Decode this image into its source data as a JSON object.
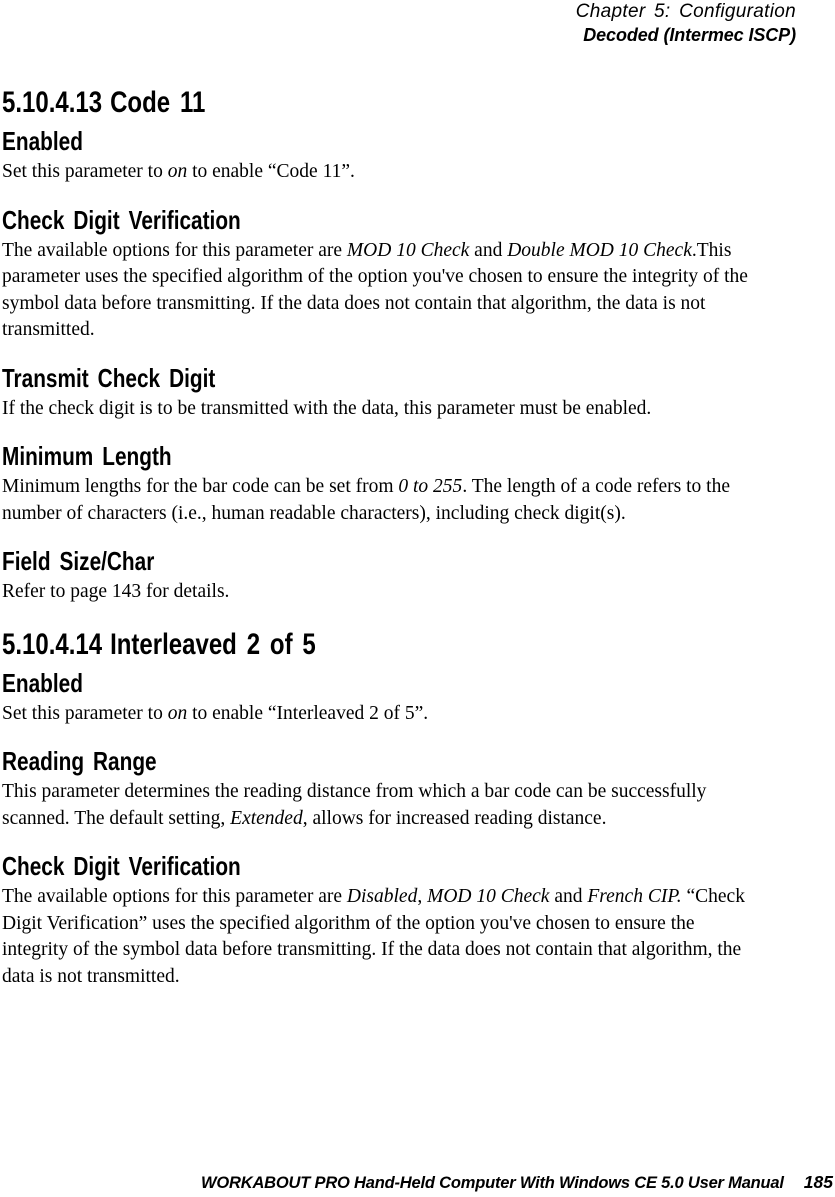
{
  "header": {
    "chapter_line": "Chapter 5: Configuration",
    "section_line": "Decoded (Intermec ISCP)"
  },
  "footer": {
    "manual_title": "WORKABOUT PRO Hand-Held Computer With Windows CE 5.0 User Manual",
    "page_number": "185"
  },
  "sections": [
    {
      "number": "5.10.4.13",
      "title": "Code 11",
      "blocks": [
        {
          "heading": "Enabled",
          "para_pre": "Set this parameter to ",
          "para_em": "on",
          "para_post": " to enable “Code 11”."
        },
        {
          "heading": "Check Digit Verification",
          "p1_pre": "The available options for this parameter are ",
          "p1_em1": "MOD 10 Check",
          "p1_mid": " and ",
          "p1_em2": "Double MOD 10 Check",
          "p1_post": ".This parameter uses the specified algorithm of the option you've chosen to ensure the integrity of the symbol data before transmitting. If the data does not contain that algorithm, the data is not transmitted."
        },
        {
          "heading": "Transmit Check Digit",
          "para": "If the check digit is to be transmitted with the data, this parameter must be enabled."
        },
        {
          "heading": "Minimum Length",
          "p_pre": "Minimum lengths for the bar code can be set from ",
          "p_em": "0 to 255",
          "p_post": ". The length of a code refers to the number of characters (i.e., human readable characters), including check digit(s)."
        },
        {
          "heading": "Field Size/Char",
          "para": "Refer to page 143 for details."
        }
      ]
    },
    {
      "number": "5.10.4.14",
      "title": "Interleaved 2 of 5",
      "blocks": [
        {
          "heading": "Enabled",
          "para_pre": "Set this parameter to ",
          "para_em": "on",
          "para_post": " to enable “Interleaved 2 of 5”."
        },
        {
          "heading": "Reading Range",
          "p_pre": "This parameter determines the reading distance from which a bar code can be successfully scanned. The default setting, ",
          "p_em": "Extended",
          "p_post": ", allows for increased reading distance."
        },
        {
          "heading": "Check Digit Verification",
          "p_pre": "The available options for this parameter are ",
          "p_em1": "Disabled",
          "p_mid1": ", ",
          "p_em2": "MOD 10 Check",
          "p_mid2": " and ",
          "p_em3": "French CIP.",
          "p_post": " “Check Digit Verification” uses the specified algorithm of the option you've chosen to ensure the integrity of the symbol data before transmitting. If the data does not contain that algorithm, the data is not transmitted."
        }
      ]
    }
  ]
}
